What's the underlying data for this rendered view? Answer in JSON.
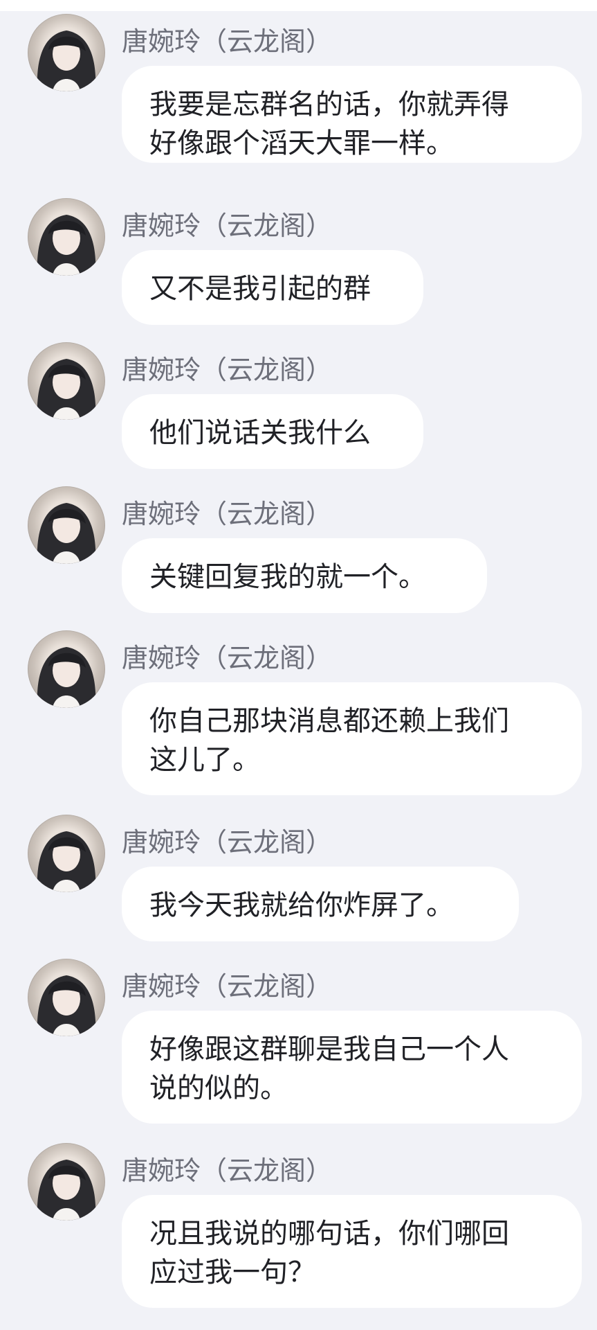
{
  "chat": {
    "messages": [
      {
        "sender": "唐婉玲（云龙阁）",
        "text": "我要是忘群名的话，你就弄得\n好像跟个滔天大罪一样。"
      },
      {
        "sender": "唐婉玲（云龙阁）",
        "text": "又不是我引起的群"
      },
      {
        "sender": "唐婉玲（云龙阁）",
        "text": "他们说话关我什么"
      },
      {
        "sender": "唐婉玲（云龙阁）",
        "text": "关键回复我的就一个。"
      },
      {
        "sender": "唐婉玲（云龙阁）",
        "text": "你自己那块消息都还赖上我们\n这儿了。"
      },
      {
        "sender": "唐婉玲（云龙阁）",
        "text": "我今天我就给你炸屏了。"
      },
      {
        "sender": "唐婉玲（云龙阁）",
        "text": "好像跟这群聊是我自己一个人\n说的似的。"
      },
      {
        "sender": "唐婉玲（云龙阁）",
        "text": "况且我说的哪句话，你们哪回\n应过我一句？"
      }
    ]
  },
  "colors": {
    "background": "#f1f2f7",
    "bubble": "#ffffff",
    "sender_text": "#6d6f7a",
    "message_text": "#202126"
  },
  "icons": {
    "avatar": "user-photo-avatar"
  }
}
